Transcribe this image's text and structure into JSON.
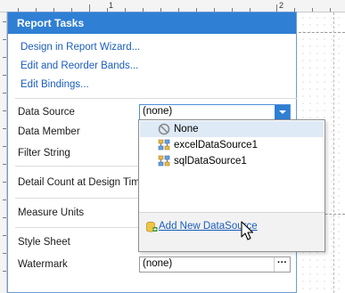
{
  "ruler": {
    "labels": [
      "1",
      "2"
    ]
  },
  "panel": {
    "title": "Report Tasks",
    "links": [
      "Design in Report Wizard...",
      "Edit and Reorder Bands...",
      "Edit Bindings..."
    ],
    "properties": {
      "data_source": "Data Source",
      "data_member": "Data Member",
      "filter_string": "Filter String",
      "detail_count": "Detail Count at Design Time",
      "measure_units": "Measure Units",
      "style_sheet": "Style Sheet",
      "watermark": "Watermark"
    },
    "data_source_value": "(none)",
    "watermark_value": "(none)",
    "watermark_button": "···"
  },
  "dropdown": {
    "items": [
      {
        "label": "None",
        "icon": "none-icon",
        "selected": true
      },
      {
        "label": "excelDataSource1",
        "icon": "datasource-icon",
        "selected": false
      },
      {
        "label": "sqlDataSource1",
        "icon": "datasource-icon",
        "selected": false
      }
    ],
    "footer_link": "Add New DataSource"
  },
  "colors": {
    "accent": "#2f7fd4",
    "link": "#1a5dbe",
    "selected_row": "#dfeaf7"
  }
}
